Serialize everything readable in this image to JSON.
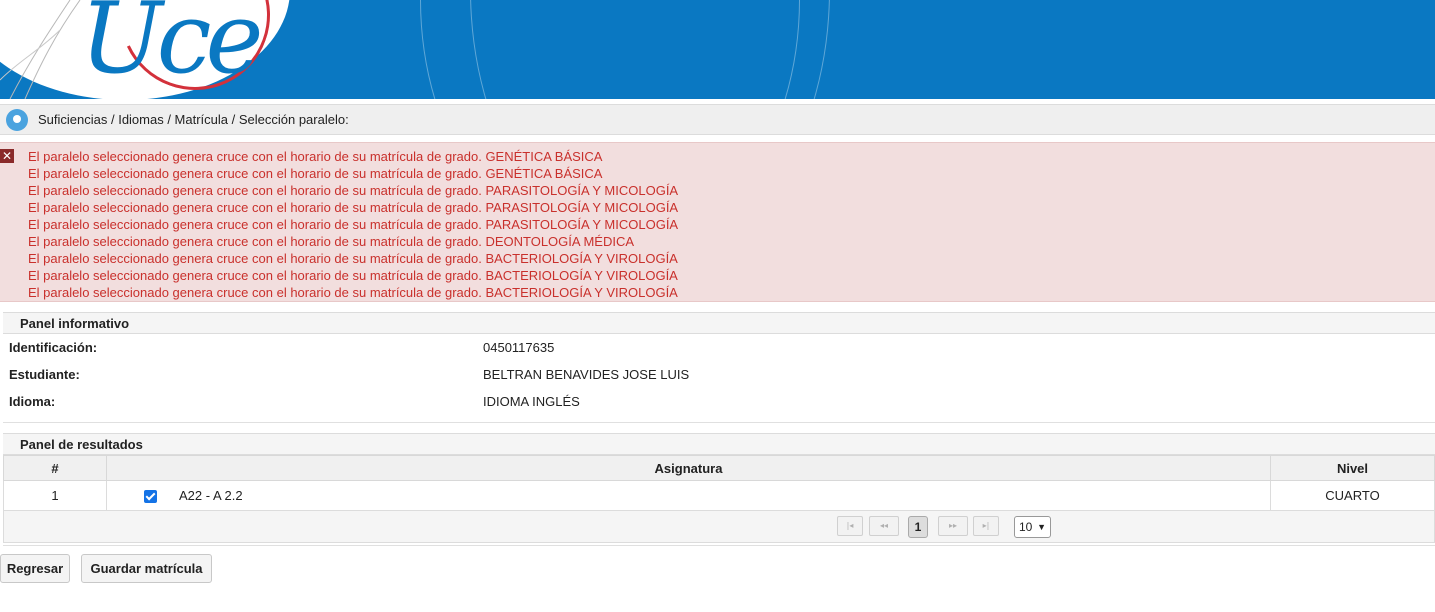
{
  "header": {
    "logo_text": "Uce"
  },
  "breadcrumb": {
    "icon": "location-pin-icon",
    "text": "Suficiencias / Idiomas / Matrícula / Selección paralelo:"
  },
  "errors": {
    "icon": "error-close-icon",
    "color": "#c9302c",
    "messages": [
      "El paralelo seleccionado genera cruce con el horario de su matrícula de grado. GENÉTICA BÁSICA",
      "El paralelo seleccionado genera cruce con el horario de su matrícula de grado. GENÉTICA BÁSICA",
      "El paralelo seleccionado genera cruce con el horario de su matrícula de grado. PARASITOLOGÍA Y MICOLOGÍA",
      "El paralelo seleccionado genera cruce con el horario de su matrícula de grado. PARASITOLOGÍA Y MICOLOGÍA",
      "El paralelo seleccionado genera cruce con el horario de su matrícula de grado. PARASITOLOGÍA Y MICOLOGÍA",
      "El paralelo seleccionado genera cruce con el horario de su matrícula de grado. DEONTOLOGÍA MÉDICA",
      "El paralelo seleccionado genera cruce con el horario de su matrícula de grado. BACTERIOLOGÍA Y VIROLOGÍA",
      "El paralelo seleccionado genera cruce con el horario de su matrícula de grado. BACTERIOLOGÍA Y VIROLOGÍA",
      "El paralelo seleccionado genera cruce con el horario de su matrícula de grado. BACTERIOLOGÍA Y VIROLOGÍA"
    ]
  },
  "info_panel": {
    "title": "Panel informativo",
    "rows": [
      {
        "label": "Identificación:",
        "value": "0450117635"
      },
      {
        "label": "Estudiante:",
        "value": "BELTRAN BENAVIDES JOSE LUIS"
      },
      {
        "label": "Idioma:",
        "value": "IDIOMA INGLÉS"
      }
    ]
  },
  "results_panel": {
    "title": "Panel de resultados",
    "columns": [
      "#",
      "Asignatura",
      "Nivel"
    ],
    "rows": [
      {
        "num": "1",
        "checked": true,
        "asignatura": "A22 - A 2.2",
        "nivel": "CUARTO"
      }
    ],
    "pager": {
      "first": "|◂",
      "prev": "◂◂",
      "current_page": "1",
      "next": "▸▸",
      "last": "▸|",
      "page_size": "10"
    }
  },
  "actions": {
    "back_label": "Regresar",
    "save_label": "Guardar matrícula"
  },
  "colors": {
    "banner": "#0a78c2",
    "error_bg": "#f2dede",
    "checkbox": "#1473e6",
    "logo_accent": "#d3313b"
  }
}
